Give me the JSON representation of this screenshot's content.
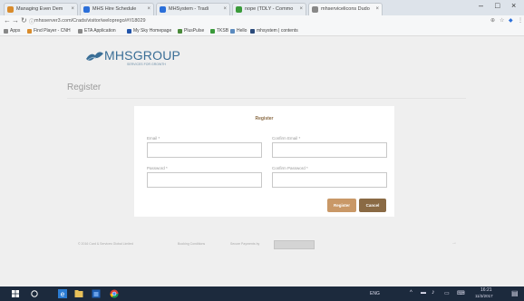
{
  "browser": {
    "tabs": [
      {
        "label": "Managing Even Dem",
        "color": "#d98b2b"
      },
      {
        "label": "MHS Hire Schedule",
        "color": "#2b6fd9"
      },
      {
        "label": "MHSystem - Tradi",
        "color": "#2b6fd9"
      },
      {
        "label": "nope (TDLY - Commo",
        "color": "#3a9a3a"
      },
      {
        "label": "mhservicelicons Dudo",
        "color": "#888888"
      }
    ],
    "window": {
      "minimize": "–",
      "maximize": "□",
      "close": "×"
    },
    "nav": {
      "back": "←",
      "forward": "→",
      "reload": "↻"
    },
    "url": "mhsserver3.com/Crads/visitor/weloprego/#!/18029",
    "bookmarks": [
      {
        "label": "Apps",
        "color": "#888888"
      },
      {
        "label": "Find Player - CNH",
        "color": "#d98b2b"
      },
      {
        "label": "ETA Application",
        "color": "#888888"
      },
      {
        "label": "My Sky Homepage",
        "color": "#2255aa"
      },
      {
        "label": "PlusPulse",
        "color": "#4a8a3a"
      },
      {
        "label": "TKSB",
        "color": "#3a9a3a"
      },
      {
        "label": "Hello",
        "color": "#5a8abf"
      },
      {
        "label": "mhsystem | contents",
        "color": "#2b4b7b"
      }
    ]
  },
  "brand": {
    "name": "MHSGROUP",
    "tagline": "SERVICES FOR GROWTH"
  },
  "page": {
    "title": "Register"
  },
  "form": {
    "heading": "Register",
    "email_label": "Email *",
    "confirm_email_label": "Confirm Email *",
    "password_label": "Password *",
    "confirm_password_label": "Confirm Password *",
    "register_button": "Register",
    "cancel_button": "Cancel"
  },
  "footer": {
    "copyright": "© 2016 Card & Services Global Limited",
    "terms": "Booking Conditions",
    "secure": "Secure Payments by"
  },
  "taskbar": {
    "lang": "ENG",
    "time": "16:21",
    "date": "11/3/2017"
  },
  "colors": {
    "accent": "#c99867",
    "accent_dark": "#8a6a44",
    "brand_blue": "#3a6e96"
  }
}
